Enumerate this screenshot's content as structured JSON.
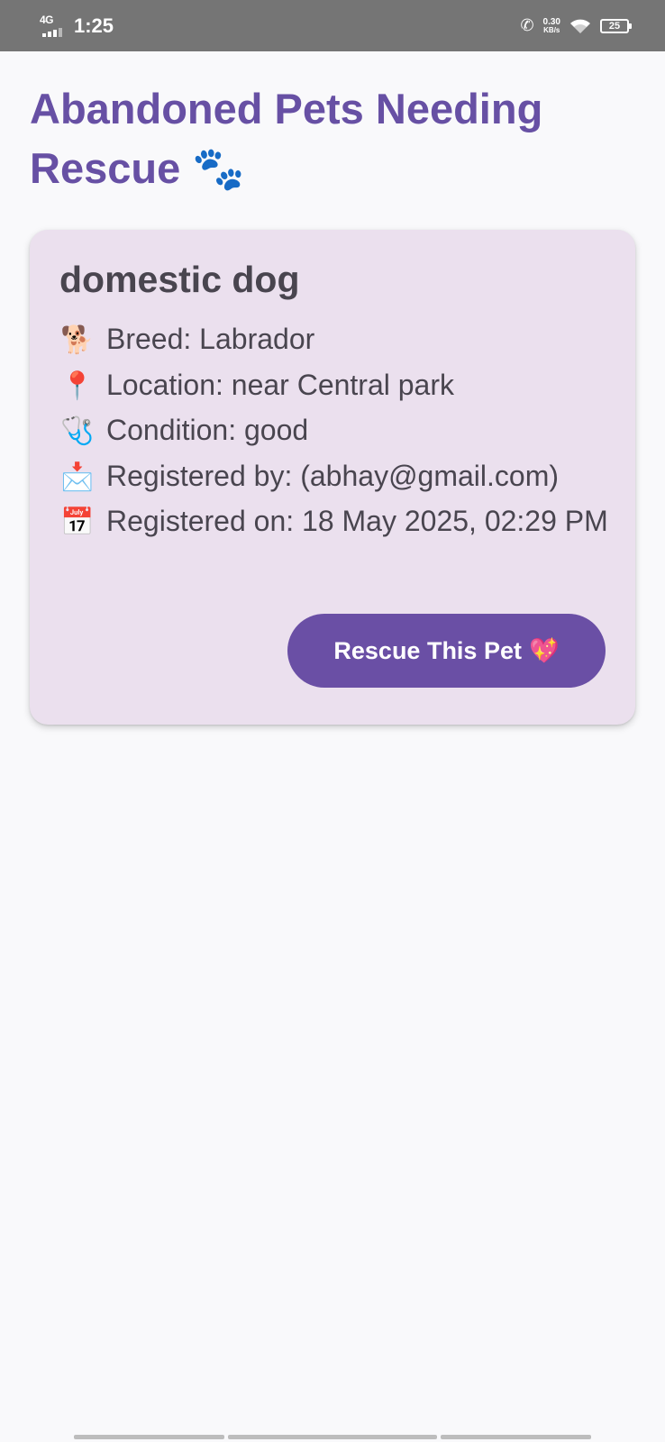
{
  "status_bar": {
    "network": "4G",
    "time": "1:25",
    "speed_value": "0.30",
    "speed_unit": "KB/s",
    "battery": "25",
    "icons": [
      "signal-icon",
      "call-icon",
      "wifi-icon",
      "battery-icon"
    ]
  },
  "page": {
    "title": "Abandoned Pets Needing Rescue 🐾",
    "accent_color": "#6750a4",
    "card_color": "#ebe0ee"
  },
  "pets": [
    {
      "name": "domestic dog",
      "breed": {
        "emoji": "🐕",
        "text": "Breed: Labrador"
      },
      "location": {
        "emoji": "📍",
        "text": "Location: near Central park"
      },
      "condition": {
        "emoji": "🩺",
        "text": "Condition: good"
      },
      "registered_by": {
        "emoji": "📩",
        "text": "Registered by:  (abhay@gmail.com)"
      },
      "registered_on": {
        "emoji": "📅",
        "text": "Registered on: 18 May 2025, 02:29 PM"
      },
      "button": {
        "label": "Rescue This Pet",
        "emoji": "💖",
        "color": "#6a4fa5"
      }
    }
  ]
}
